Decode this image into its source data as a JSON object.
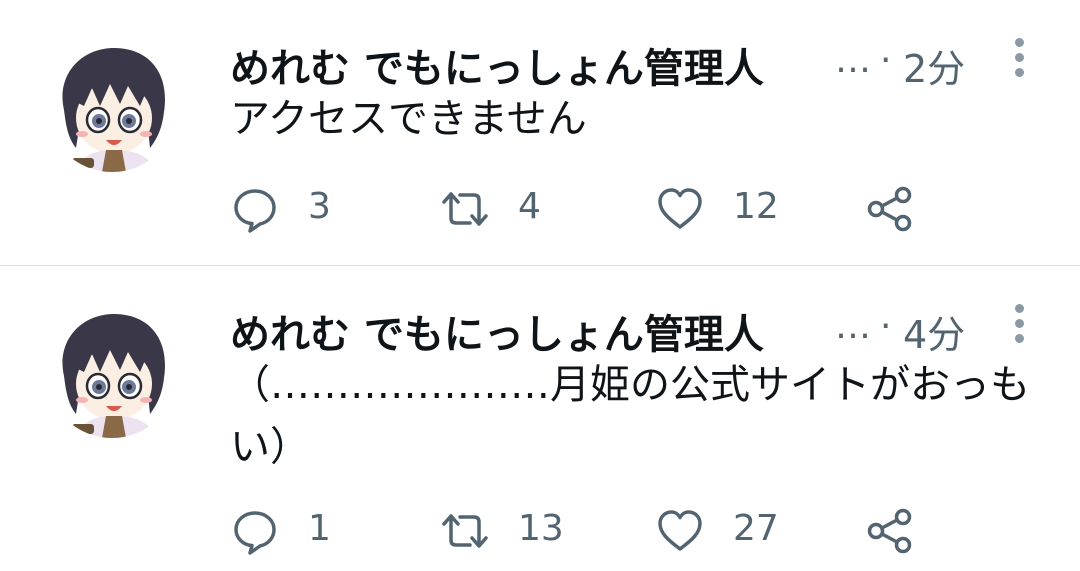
{
  "colors": {
    "text_primary": "#0f1419",
    "text_secondary": "#536471",
    "icon": "#536471",
    "divider": "#dcdfe2"
  },
  "tweets": [
    {
      "author_name": "めれむ でもにっしょん管理人",
      "ellipsis": "…",
      "separator": "·",
      "time": "2分",
      "text": "アクセスできません",
      "reply_count": "3",
      "retweet_count": "4",
      "like_count": "12",
      "icons": [
        "avatar",
        "more-icon",
        "reply-icon",
        "retweet-icon",
        "like-icon",
        "share-icon"
      ]
    },
    {
      "author_name": "めれむ でもにっしょん管理人",
      "ellipsis": "…",
      "separator": "·",
      "time": "4分",
      "text": "（…………………月姫の公式サイトがおっもい）",
      "reply_count": "1",
      "retweet_count": "13",
      "like_count": "27",
      "icons": [
        "avatar",
        "more-icon",
        "reply-icon",
        "retweet-icon",
        "like-icon",
        "share-icon"
      ]
    }
  ]
}
